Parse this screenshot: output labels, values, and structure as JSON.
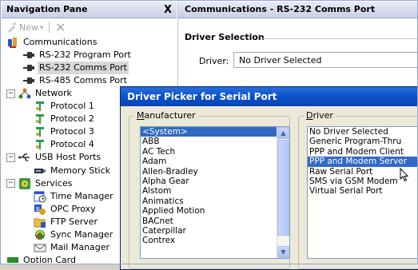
{
  "nav": {
    "title": "Navigation Pane",
    "close_glyph": "X",
    "toolbar": {
      "new_label": "New"
    },
    "tree": [
      {
        "label": "Communications",
        "icon": "communications-icon",
        "level": 0,
        "expander": "",
        "selected": false
      },
      {
        "label": "RS-232 Program Port",
        "icon": "serial-port-icon",
        "level": 1,
        "expander": "",
        "selected": false
      },
      {
        "label": "RS-232 Comms Port",
        "icon": "serial-port-icon",
        "level": 1,
        "expander": "",
        "selected": true
      },
      {
        "label": "RS-485 Comms Port",
        "icon": "serial-port-icon",
        "level": 1,
        "expander": "",
        "selected": false
      },
      {
        "label": "Network",
        "icon": "network-icon",
        "level": 0,
        "expander": "−",
        "selected": false
      },
      {
        "label": "Protocol 1",
        "icon": "protocol-icon",
        "level": 1,
        "expander": "",
        "selected": false
      },
      {
        "label": "Protocol 2",
        "icon": "protocol-icon",
        "level": 1,
        "expander": "",
        "selected": false
      },
      {
        "label": "Protocol 3",
        "icon": "protocol-icon",
        "level": 1,
        "expander": "",
        "selected": false
      },
      {
        "label": "Protocol 4",
        "icon": "protocol-icon",
        "level": 1,
        "expander": "",
        "selected": false
      },
      {
        "label": "USB Host Ports",
        "icon": "usb-icon",
        "level": 0,
        "expander": "−",
        "selected": false
      },
      {
        "label": "Memory Stick",
        "icon": "memory-stick-icon",
        "level": 1,
        "expander": "",
        "selected": false
      },
      {
        "label": "Services",
        "icon": "services-icon",
        "level": 0,
        "expander": "−",
        "selected": false
      },
      {
        "label": "Time Manager",
        "icon": "time-manager-icon",
        "level": 1,
        "expander": "",
        "selected": false
      },
      {
        "label": "OPC Proxy",
        "icon": "opc-proxy-icon",
        "level": 1,
        "expander": "",
        "selected": false
      },
      {
        "label": "FTP Server",
        "icon": "ftp-server-icon",
        "level": 1,
        "expander": "",
        "selected": false
      },
      {
        "label": "Sync Manager",
        "icon": "sync-manager-icon",
        "level": 1,
        "expander": "",
        "selected": false
      },
      {
        "label": "Mail Manager",
        "icon": "mail-manager-icon",
        "level": 1,
        "expander": "",
        "selected": false
      },
      {
        "label": "Option Card",
        "icon": "option-card-icon",
        "level": 0,
        "expander": "",
        "selected": false
      }
    ]
  },
  "comm": {
    "title": "Communications - RS-232 Comms Port",
    "section": "Driver Selection",
    "driver_label": "Driver:",
    "driver_value": "No Driver Selected"
  },
  "dialog": {
    "title": "Driver Picker for Serial Port",
    "manufacturer_label_first": "M",
    "manufacturer_label_rest": "anufacturer",
    "driver_label_first": "D",
    "driver_label_rest": "river",
    "manufacturers": [
      "<System>",
      "ABB",
      "AC Tech",
      "Adam",
      "Allen-Bradley",
      "Alpha Gear",
      "Alstom",
      "Animatics",
      "Applied Motion",
      "BACnet",
      "Caterpillar",
      "Contrex"
    ],
    "manufacturer_selected": 0,
    "drivers": [
      "No Driver Selected",
      "Generic Program-Thru",
      "PPP and Modem Client",
      "PPP and Modem Server",
      "Raw Serial Port",
      "SMS via GSM Modem",
      "Virtual Serial Port"
    ],
    "driver_selected": 3
  }
}
